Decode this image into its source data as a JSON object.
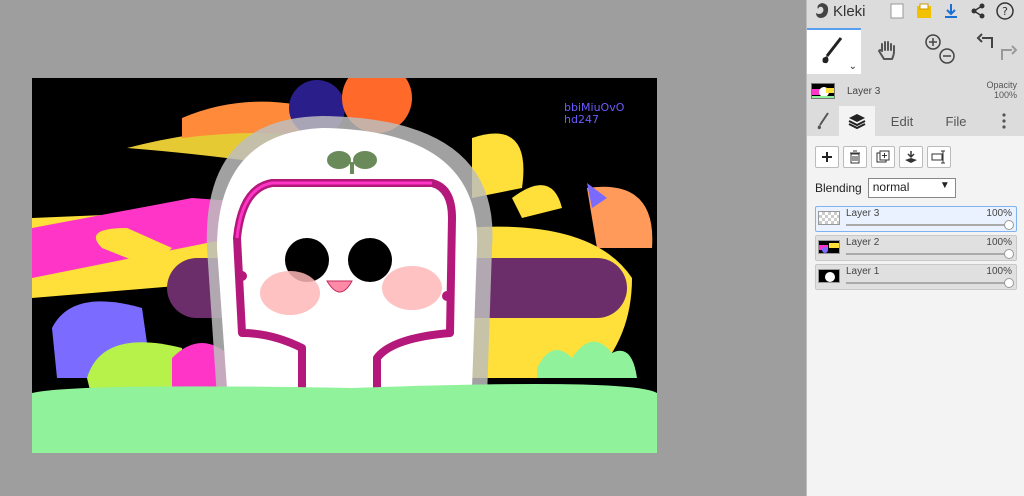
{
  "app": {
    "name": "Kleki"
  },
  "canvas": {
    "watermark_line1": "bbiMiuOvO",
    "watermark_line2": "hd247",
    "background": "#000000"
  },
  "toolbar": {
    "icons": [
      "new-image-icon",
      "save-icon",
      "download-icon",
      "share-icon",
      "help-icon"
    ],
    "tools": [
      "brush-icon",
      "hand-icon",
      "zoom-in-icon",
      "zoom-out-icon",
      "undo-icon",
      "redo-icon"
    ]
  },
  "layer_info": {
    "name": "Layer 3",
    "opacity_label": "Opacity",
    "opacity_value": "100%"
  },
  "tabs": [
    {
      "label": "",
      "icon": "brush-tab-icon"
    },
    {
      "label": "",
      "icon": "layers-icon"
    },
    {
      "label": "Edit"
    },
    {
      "label": "File"
    },
    {
      "label": "",
      "icon": "more-icon"
    }
  ],
  "layer_panel": {
    "blending_label": "Blending",
    "blending_value": "normal",
    "layers": [
      {
        "name": "Layer 3",
        "opacity": "100%",
        "selected": true
      },
      {
        "name": "Layer 2",
        "opacity": "100%",
        "selected": false
      },
      {
        "name": "Layer 1",
        "opacity": "100%",
        "selected": false
      }
    ]
  },
  "colors": {
    "accent": "#5aa0f0",
    "green": "#90f29a",
    "pink": "#ff35c8",
    "yellow": "#ffe03a",
    "purple": "#6b2e6a"
  }
}
